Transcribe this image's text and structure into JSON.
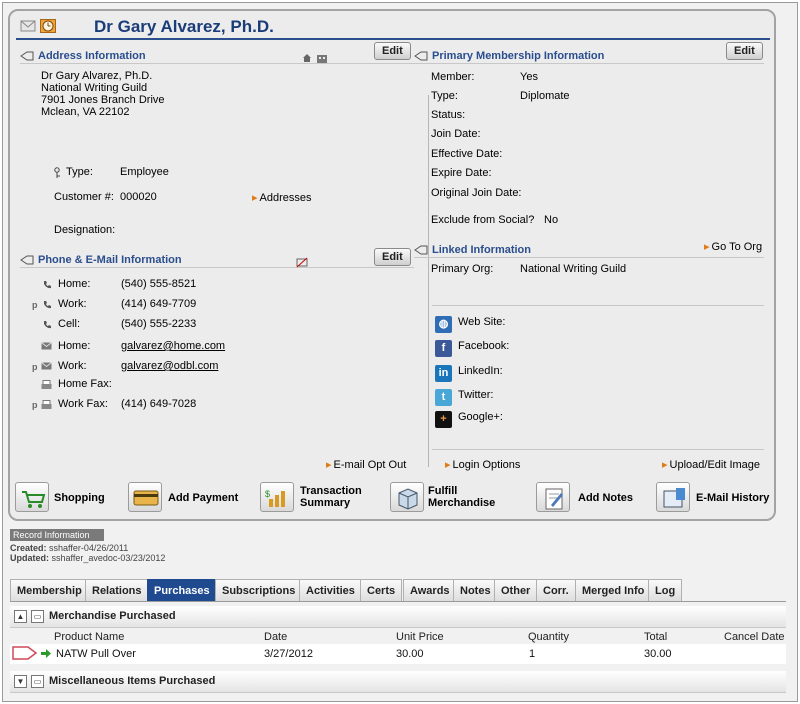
{
  "header": {
    "title": "Dr Gary Alvarez, Ph.D."
  },
  "address": {
    "section_title": "Address Information",
    "edit_label": "Edit",
    "lines": [
      "Dr Gary Alvarez, Ph.D.",
      "National Writing Guild",
      "7901 Jones Branch Drive",
      "Mclean, VA 22102"
    ],
    "type_label": "Type:",
    "type_value": "Employee",
    "customer_label": "Customer #:",
    "customer_value": "000020",
    "addresses_link": "Addresses",
    "designation_label": "Designation:"
  },
  "membership": {
    "section_title": "Primary Membership Information",
    "edit_label": "Edit",
    "fields": [
      {
        "label": "Member:",
        "value": "Yes"
      },
      {
        "label": "Type:",
        "value": "Diplomate"
      },
      {
        "label": "Status:",
        "value": ""
      },
      {
        "label": "Join Date:",
        "value": ""
      },
      {
        "label": "Effective Date:",
        "value": ""
      },
      {
        "label": "Expire Date:",
        "value": ""
      },
      {
        "label": "Original Join Date:",
        "value": ""
      }
    ],
    "exclude_label": "Exclude from Social?",
    "exclude_value": "No"
  },
  "phone": {
    "section_title": "Phone & E-Mail Information",
    "edit_label": "Edit",
    "primary_marker": "p",
    "rows": [
      {
        "label": "Home:",
        "value": "(540) 555-8521"
      },
      {
        "label": "Work:",
        "value": "(414) 649-7709"
      },
      {
        "label": "Cell:",
        "value": "(540) 555-2233"
      },
      {
        "label": "Home:",
        "value": "galvarez@home.com"
      },
      {
        "label": "Work:",
        "value": "galvarez@odbl.com"
      },
      {
        "label": "Home Fax:",
        "value": ""
      },
      {
        "label": "Work Fax:",
        "value": "(414) 649-7028"
      }
    ],
    "email_opt_out": "E-mail Opt Out"
  },
  "linked": {
    "section_title": "Linked Information",
    "go_to_org": "Go To Org",
    "primary_org_label": "Primary Org:",
    "primary_org_value": "National Writing Guild",
    "social": [
      {
        "label": "Web Site:",
        "icon": "globe-icon",
        "color": "#2f6db5"
      },
      {
        "label": "Facebook:",
        "icon": "facebook-icon",
        "color": "#3b5998"
      },
      {
        "label": "LinkedIn:",
        "icon": "linkedin-icon",
        "color": "#1a75bb"
      },
      {
        "label": "Twitter:",
        "icon": "twitter-icon",
        "color": "#49a7d8"
      },
      {
        "label": "Google+:",
        "icon": "google-plus-icon",
        "color": "#111111"
      }
    ],
    "login_options": "Login Options",
    "upload_image": "Upload/Edit Image"
  },
  "actions": [
    {
      "label": "Shopping",
      "icon": "cart-icon"
    },
    {
      "label": "Add Payment",
      "icon": "credit-card-icon"
    },
    {
      "label": "Transaction Summary",
      "line1": "Transaction",
      "line2": "Summary",
      "icon": "bar-chart-icon"
    },
    {
      "label": "Fulfill Merchandise",
      "line1": "Fulfill",
      "line2": "Merchandise",
      "icon": "box-icon"
    },
    {
      "label": "Add Notes",
      "icon": "notes-icon"
    },
    {
      "label": "E-Mail History",
      "icon": "email-history-icon"
    }
  ],
  "record": {
    "title": "Record Information",
    "created_label": "Created:",
    "created_value": "sshaffer-04/26/2011",
    "updated_label": "Updated:",
    "updated_value": "sshaffer_avedoc-03/23/2012"
  },
  "tabs": [
    "Membership",
    "Relations",
    "Purchases",
    "Subscriptions",
    "Activities",
    "Certs",
    "Awards",
    "Notes",
    "Other",
    "Corr.",
    "Merged Info",
    "Log"
  ],
  "active_tab": "Purchases",
  "merchandise": {
    "title": "Merchandise Purchased",
    "columns": [
      "Product Name",
      "Date",
      "Unit Price",
      "Quantity",
      "Total",
      "Cancel Date"
    ],
    "rows": [
      {
        "product": "NATW Pull Over",
        "date": "3/27/2012",
        "unit_price": "30.00",
        "quantity": "1",
        "total": "30.00",
        "cancel_date": ""
      }
    ]
  },
  "misc": {
    "title": "Miscellaneous Items Purchased"
  },
  "colors": {
    "accent": "#1f4a8f",
    "link_arrow": "#e07b16",
    "section_text": "#2a4d8d"
  }
}
